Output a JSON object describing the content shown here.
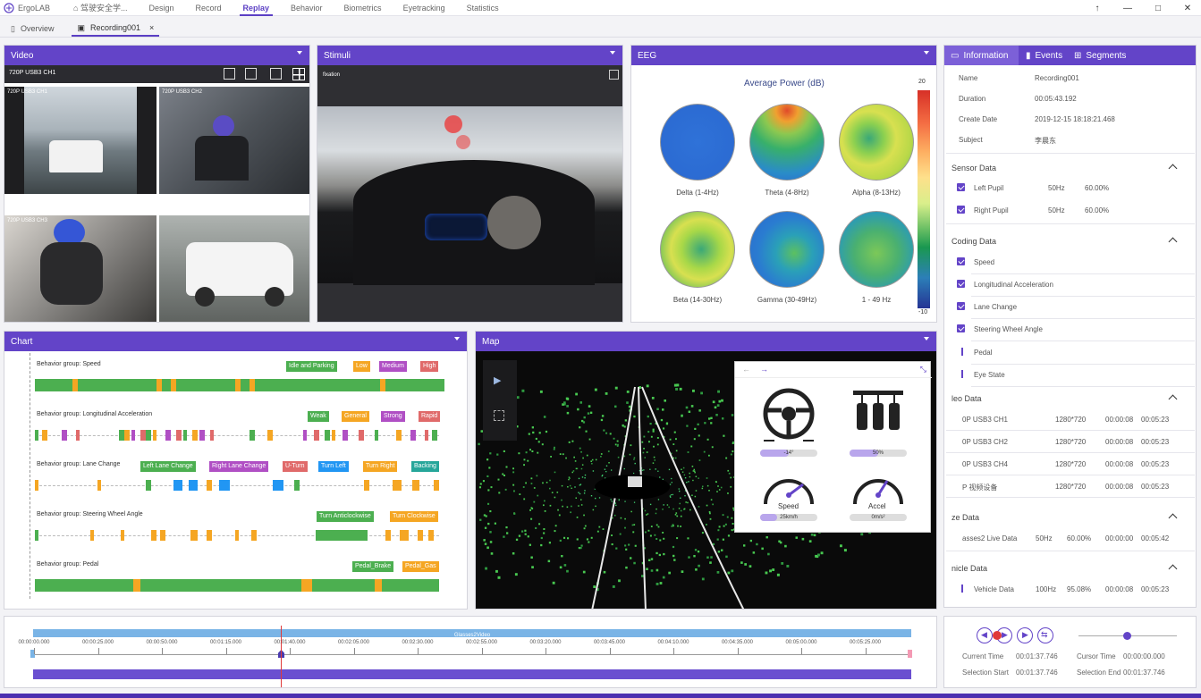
{
  "app": {
    "title": "ErgoLAB",
    "project": "驾驶安全学..."
  },
  "menu": [
    "Design",
    "Record",
    "Replay",
    "Behavior",
    "Biometrics",
    "Eyetracking",
    "Statistics"
  ],
  "active_menu": "Replay",
  "tabs": [
    {
      "label": "Overview"
    },
    {
      "label": "Recording001"
    }
  ],
  "video": {
    "title": "Video",
    "source": "720P USB3 CH1",
    "cells": [
      "720P USB3 CH1",
      "720P USB3 CH2",
      "720P USB3 CH3",
      ""
    ]
  },
  "stimuli": {
    "title": "Stimuli",
    "label": "fixation"
  },
  "eeg": {
    "title": "EEG",
    "chart_title": "Average Power (dB)",
    "scale_max": "20",
    "scale_min": "-10",
    "bands": [
      "Delta (1-4Hz)",
      "Theta (4-8Hz)",
      "Alpha (8-13Hz)",
      "Beta (14-30Hz)",
      "Gamma (30-49Hz)",
      "1 - 49 Hz"
    ]
  },
  "chart": {
    "title": "Chart",
    "groups": [
      {
        "name": "Behavior group: Speed",
        "tags": [
          {
            "l": "Idle and Parking",
            "c": "#4caf50"
          },
          {
            "l": "Low",
            "c": "#f5a623"
          },
          {
            "l": "Medium",
            "c": "#b04fc4"
          },
          {
            "l": "High",
            "c": "#e06a6a"
          }
        ]
      },
      {
        "name": "Behavior group: Longitudinal Acceleration",
        "tags": [
          {
            "l": "Weak",
            "c": "#4caf50"
          },
          {
            "l": "General",
            "c": "#f5a623"
          },
          {
            "l": "Strong",
            "c": "#b04fc4"
          },
          {
            "l": "Rapid",
            "c": "#e06a6a"
          }
        ]
      },
      {
        "name": "Behavior group: Lane Change",
        "tags": [
          {
            "l": "Left Lane Change",
            "c": "#4caf50"
          },
          {
            "l": "Right Lane Change",
            "c": "#b04fc4"
          },
          {
            "l": "U-Turn",
            "c": "#e06a6a"
          },
          {
            "l": "Turn Left",
            "c": "#2196f3"
          },
          {
            "l": "Turn Right",
            "c": "#f5a623"
          },
          {
            "l": "Backing",
            "c": "#26a69a"
          }
        ]
      },
      {
        "name": "Behavior group: Steering Wheel Angle",
        "tags": [
          {
            "l": "Turn Anticlockwise",
            "c": "#4caf50"
          },
          {
            "l": "Turn Clockwise",
            "c": "#f5a623"
          }
        ]
      },
      {
        "name": "Behavior group: Pedal",
        "tags": [
          {
            "l": "Pedal_Brake",
            "c": "#4caf50"
          },
          {
            "l": "Pedal_Gas",
            "c": "#f5a623"
          }
        ]
      }
    ]
  },
  "map": {
    "title": "Map",
    "gauges": {
      "steering_value": "-14°",
      "gear_value": "50%",
      "speed_label": "Speed",
      "speed_value": "25km/h",
      "accel_label": "Accel",
      "accel_value": "0m/s²"
    }
  },
  "info": {
    "tabs": [
      "Information",
      "Events",
      "Segments"
    ],
    "fields": [
      {
        "k": "Name",
        "v": "Recording001"
      },
      {
        "k": "Duration",
        "v": "00:05:43.192"
      },
      {
        "k": "Create Date",
        "v": "2019-12-15 18:18:21.468"
      },
      {
        "k": "Subject",
        "v": "李晨东"
      }
    ],
    "sensor_title": "Sensor Data",
    "sensor": [
      {
        "n": "Left Pupil",
        "f": "50Hz",
        "p": "60.00%"
      },
      {
        "n": "Right Pupil",
        "f": "50Hz",
        "p": "60.00%"
      }
    ],
    "coding_title": "Coding Data",
    "coding": [
      "Speed",
      "Longitudinal Acceleration",
      "Lane Change",
      "Steering Wheel Angle",
      "Pedal",
      "Eye State"
    ],
    "video_title": "leo Data",
    "videos": [
      {
        "n": "0P USB3 CH1",
        "r": "1280*720",
        "s": "00:00:08",
        "e": "00:05:23"
      },
      {
        "n": "0P USB3 CH2",
        "r": "1280*720",
        "s": "00:00:08",
        "e": "00:05:23"
      },
      {
        "n": "0P USB3 CH4",
        "r": "1280*720",
        "s": "00:00:08",
        "e": "00:05:23"
      },
      {
        "n": "P 视频设备",
        "r": "1280*720",
        "s": "00:00:08",
        "e": "00:05:23"
      }
    ],
    "eye_title": "ze Data",
    "eye": {
      "n": "asses2 Live Data",
      "f": "50Hz",
      "p": "60.00%",
      "s": "00:00:00",
      "e": "00:05:42"
    },
    "vehicle_title": "nicle Data",
    "vehicle": {
      "n": "Vehicle Data",
      "f": "100Hz",
      "p": "95.08%",
      "s": "00:00:08",
      "e": "00:05:23"
    }
  },
  "timeline": {
    "bar_label": "Glasses2Video",
    "ticks": [
      "00:00:00.000",
      "00:00:25.000",
      "00:00:50.000",
      "00:01:15.000",
      "00:01:40.000",
      "00:02:05.000",
      "00:02:30.000",
      "00:02:55.000",
      "00:03:20.000",
      "00:03:45.000",
      "00:04:10.000",
      "00:04:35.000",
      "00:05:00.000",
      "00:05:25.000"
    ]
  },
  "playback": {
    "current_label": "Current Time",
    "current": "00:01:37.746",
    "cursor_label": "Cursor Time",
    "cursor": "00:00:00.000",
    "sel_start_label": "Selection Start",
    "sel_start": "00:01:37.746",
    "sel_end_label": "Selection End",
    "sel_end": "00:01:37.746"
  }
}
